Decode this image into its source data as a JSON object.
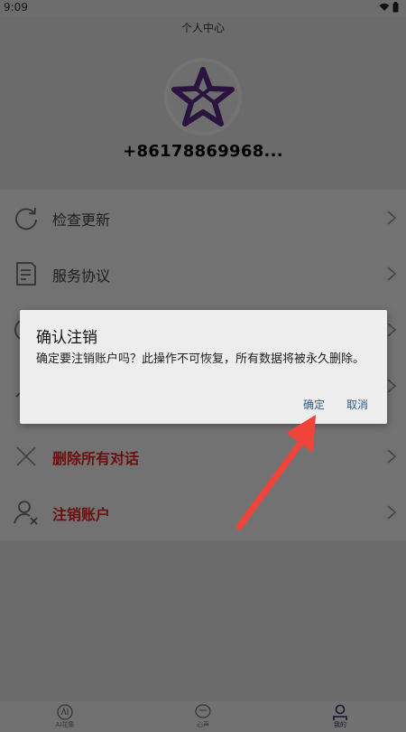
{
  "status_bar": {
    "time": "9:09"
  },
  "header": {
    "title": "个人中心"
  },
  "profile": {
    "phone": "+86178869968..."
  },
  "menu": {
    "items": [
      {
        "label": "检查更新",
        "icon": "refresh-icon"
      },
      {
        "label": "服务协议",
        "icon": "document-icon"
      },
      {
        "label": "",
        "icon": "info-icon"
      },
      {
        "label": "",
        "icon": "user-icon"
      },
      {
        "label": "删除所有对话",
        "icon": "close-icon",
        "danger": true
      },
      {
        "label": "注销账户",
        "icon": "user-remove-icon",
        "danger": true
      }
    ]
  },
  "dialog": {
    "title": "确认注销",
    "message": "确定要注销账户吗？此操作不可恢复，所有数据将被永久删除。",
    "confirm_label": "确定",
    "cancel_label": "取消"
  },
  "bottom_nav": {
    "items": [
      {
        "label": "AI花集",
        "icon": "ai-icon"
      },
      {
        "label": "心声",
        "icon": "heart-chat-icon"
      },
      {
        "label": "我的",
        "icon": "profile-icon"
      }
    ]
  },
  "colors": {
    "accent": "#2b5b88",
    "danger": "#6b0f0f",
    "overlay": "#6b6b6b"
  }
}
